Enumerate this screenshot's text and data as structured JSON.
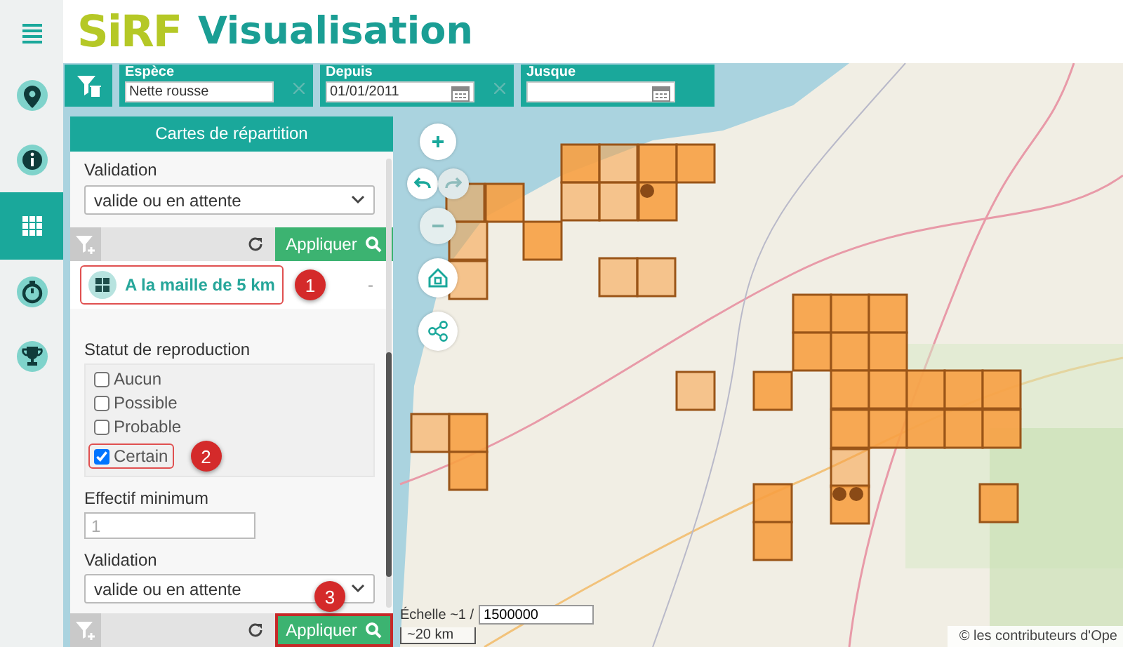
{
  "sidebar": {
    "items": [
      {
        "kind": "marker",
        "selected": false
      },
      {
        "kind": "info",
        "selected": false
      },
      {
        "kind": "grid",
        "selected": true
      },
      {
        "kind": "timer",
        "selected": false
      },
      {
        "kind": "trophy",
        "selected": false
      }
    ]
  },
  "header": {
    "logo": "SiRF",
    "title": "Visualisation"
  },
  "filters": [
    {
      "label": "Espèce",
      "value": "Nette rousse",
      "kind": "text",
      "clearable": true
    },
    {
      "label": "Depuis",
      "value": "01/01/2011",
      "kind": "date",
      "clearable": true
    },
    {
      "label": "Jusque",
      "kind": "date",
      "clearable": false
    }
  ],
  "panel": {
    "title": "Cartes de répartition",
    "validation_top": {
      "label": "Validation",
      "value": "valide ou en attente"
    },
    "apply_top": {
      "label": "Appliquer",
      "highlighted": false
    },
    "mode": {
      "label": "A la maille de 5 km",
      "trailing": "-",
      "callout": "1"
    },
    "breeding": {
      "label": "Statut de reproduction",
      "options": [
        {
          "label": "Aucun",
          "checked": false
        },
        {
          "label": "Possible",
          "checked": false
        },
        {
          "label": "Probable",
          "checked": false
        },
        {
          "label": "Certain",
          "checked": true,
          "callout": "2"
        }
      ]
    },
    "min_count": {
      "label": "Effectif minimum",
      "placeholder": "1"
    },
    "validation": {
      "label": "Validation",
      "value": "valide ou en attente",
      "callout": "3"
    },
    "apply": {
      "label": "Appliquer",
      "highlighted": true
    }
  },
  "map": {
    "scale_label": "Échelle ~1 /",
    "scale_value": "1500000",
    "scale_bar": "~20 km",
    "attribution": "© les contributeurs d'Ope"
  }
}
